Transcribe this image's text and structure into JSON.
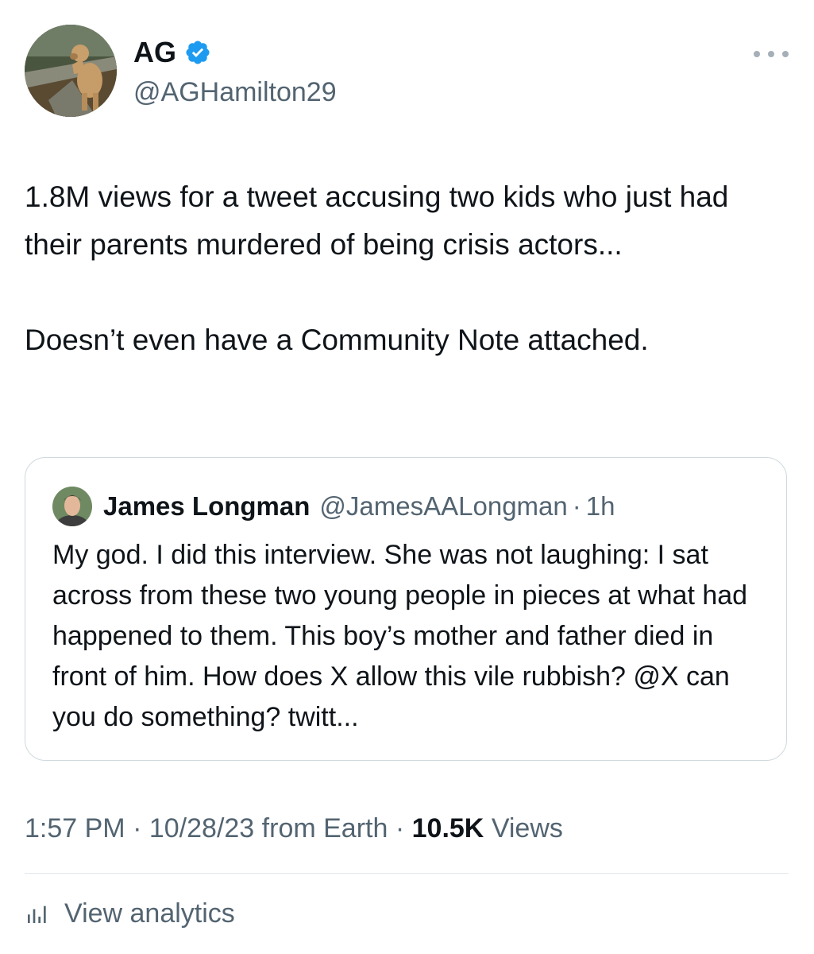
{
  "author": {
    "display_name": "AG",
    "handle": "@AGHamilton29",
    "verified": true
  },
  "tweet": {
    "paragraphs": [
      "1.8M views for a tweet accusing two kids who just had their parents murdered of being crisis actors...",
      "Doesn’t even have a Community Note attached."
    ]
  },
  "quote": {
    "name": "James Longman",
    "handle": "@JamesAALongman",
    "separator": "·",
    "time": "1h",
    "text": "My god. I did this interview. She was not laughing: I sat across from these two young people in pieces at what had happened to them. This boy’s mother and father died in front of him. How does X allow this vile rubbish? @X can you do something? twitt..."
  },
  "meta": {
    "time": "1:57 PM",
    "separator": "·",
    "date": "10/28/23",
    "source": "from Earth",
    "views_count": "10.5K",
    "views_label": "Views"
  },
  "analytics": {
    "label": "View analytics"
  },
  "colors": {
    "verified_blue": "#1d9bf0",
    "text_primary": "#0f1419",
    "text_secondary": "#536471",
    "border": "#cfd9de"
  }
}
